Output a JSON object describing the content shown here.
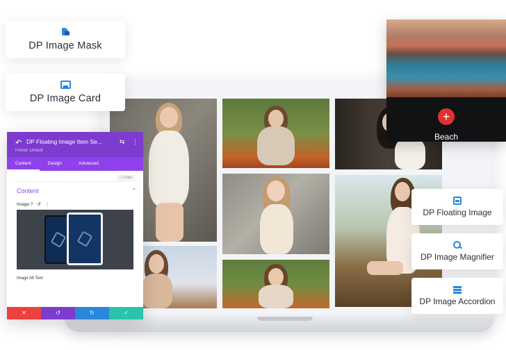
{
  "left_cards": {
    "mask": {
      "title": "DP Image Mask",
      "icon": "image-mask-icon"
    },
    "card": {
      "title": "DP Image Card",
      "icon": "image-card-icon"
    }
  },
  "right_cards": {
    "floating": {
      "title": "DP Floating Image",
      "icon": "floating-image-icon"
    },
    "magnifier": {
      "title": "DP Image Magnifier",
      "icon": "magnifier-icon"
    },
    "accordion": {
      "title": "DP Image Accordion",
      "icon": "accordion-icon"
    }
  },
  "beach_card": {
    "title": "Beach",
    "action_glyph": "+"
  },
  "builder_panel": {
    "back_glyph": "↶",
    "title": "DP Floating Image Item Se...",
    "subtitle": "Preset: Default",
    "header_icons": [
      "⇆",
      "⋮"
    ],
    "tabs": [
      "Content",
      "Design",
      "Advanced"
    ],
    "filter_label": "+ Filter",
    "section_title": "Content",
    "section_caret": "⌃",
    "image_label": "Image ?",
    "image_controls": [
      "↺",
      "⋮"
    ],
    "alt_label": "Image Alt Text",
    "footer": [
      {
        "glyph": "✕",
        "color": "#ef4040"
      },
      {
        "glyph": "↺",
        "color": "#7e3bd0"
      },
      {
        "glyph": "↻",
        "color": "#2b87da"
      },
      {
        "glyph": "✓",
        "color": "#29c4a9"
      }
    ]
  },
  "colors": {
    "accent_blue": "#2b87da",
    "panel_purple": "#7e3bd0",
    "red": "#e03131"
  }
}
